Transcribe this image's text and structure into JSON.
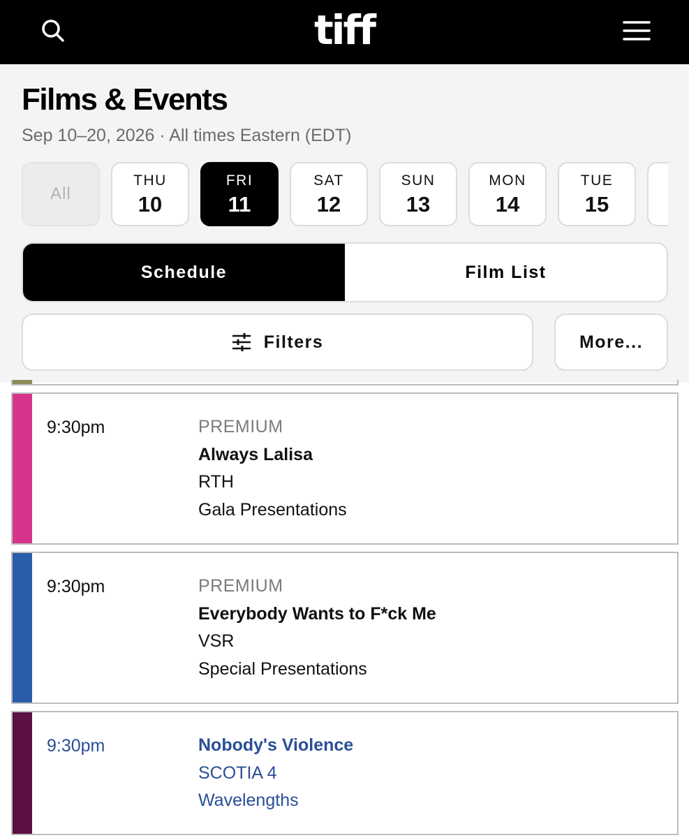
{
  "topbar": {
    "logo_text": "tiff",
    "search_icon": "search-icon",
    "menu_icon": "hamburger-menu-icon"
  },
  "header": {
    "title": "Films & Events",
    "subtitle": "Sep 10–20, 2026 · All times Eastern (EDT)"
  },
  "dates": {
    "all_label": "All",
    "items": [
      {
        "dow": "THU",
        "num": "10"
      },
      {
        "dow": "FRI",
        "num": "11"
      },
      {
        "dow": "SAT",
        "num": "12"
      },
      {
        "dow": "SUN",
        "num": "13"
      },
      {
        "dow": "MON",
        "num": "14"
      },
      {
        "dow": "TUE",
        "num": "15"
      }
    ],
    "selected": "FRI 11"
  },
  "view_toggle": {
    "schedule_label": "Schedule",
    "film_list_label": "Film List",
    "active": "Schedule"
  },
  "filters": {
    "filters_label": "Filters",
    "filters_icon": "sliders-icon",
    "more_label": "More..."
  },
  "events": [
    {
      "time": "9:30pm",
      "tag": "PREMIUM",
      "title": "Always Lalisa",
      "venue": "RTH",
      "program": "Gala Presentations",
      "color": "#d6358b"
    },
    {
      "time": "9:30pm",
      "tag": "PREMIUM",
      "title": "Everybody Wants to F*ck Me",
      "venue": "VSR",
      "program": "Special Presentations",
      "color": "#2a5ca8"
    },
    {
      "time": "9:30pm",
      "title": "Nobody's Violence",
      "venue": "SCOTIA 4",
      "program": "Wavelengths",
      "color": "#5c1044"
    }
  ],
  "colors": {
    "accent_link": "#2a4f97",
    "partial_card_stripe": "#8a8a5a"
  }
}
